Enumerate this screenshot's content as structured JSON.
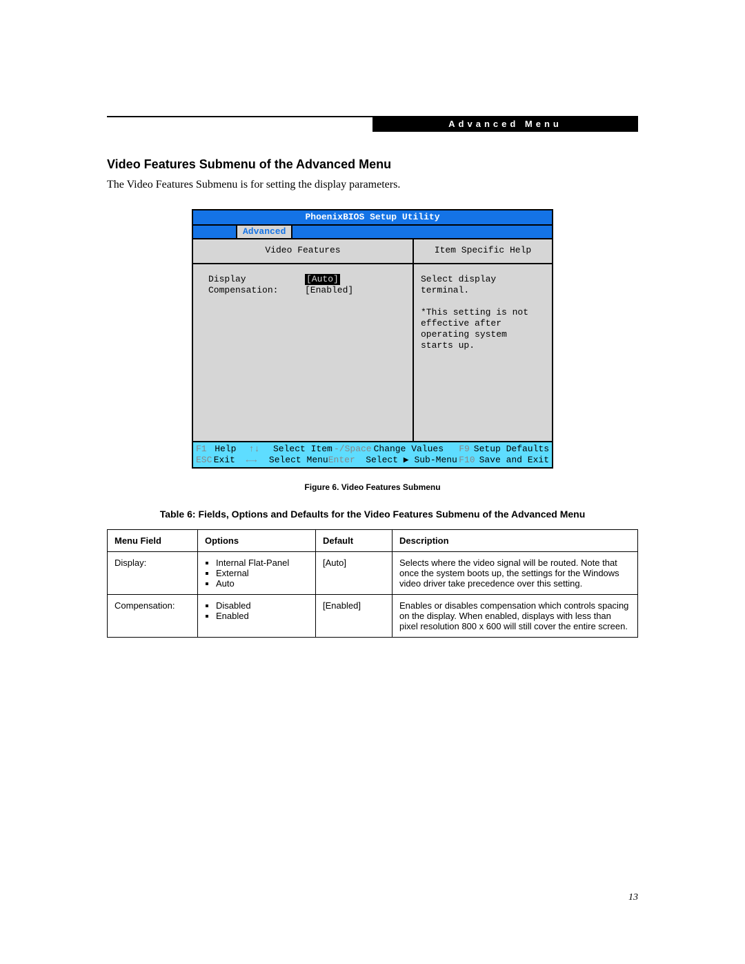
{
  "header": {
    "label": "Advanced Menu"
  },
  "section": {
    "heading": "Video Features Submenu of the Advanced Menu",
    "intro": "The Video Features Submenu is for setting the display parameters."
  },
  "bios": {
    "title": "PhoenixBIOS Setup Utility",
    "menu_tab": "Advanced",
    "left_header": "Video Features",
    "right_header": "Item Specific Help",
    "fields": {
      "display_label": "Display",
      "display_value": "[Auto]",
      "comp_label": "Compensation:",
      "comp_value": "[Enabled]"
    },
    "help": {
      "line1": "Select display terminal.",
      "line2": "*This setting is not",
      "line3": "effective after",
      "line4": "operating system",
      "line5": "starts up."
    },
    "footer": {
      "r1": {
        "k1": "F1",
        "a1": "Help",
        "k2": "↑↓",
        "a2": "Select Item",
        "k3": "-/Space",
        "a3": "Change Values",
        "k4": "F9",
        "a4": "Setup Defaults"
      },
      "r2": {
        "k1": "ESC",
        "a1": "Exit",
        "k2": "←→",
        "a2": "Select Menu",
        "k3": "Enter",
        "a3": "Select ▶ Sub-Menu",
        "k4": "F10",
        "a4": "Save and Exit"
      }
    }
  },
  "figure_caption": "Figure 6.   Video Features Submenu",
  "table": {
    "title": "Table 6: Fields, Options and Defaults for the Video Features Submenu of the Advanced Menu",
    "headers": {
      "field": "Menu Field",
      "options": "Options",
      "def": "Default",
      "desc": "Description"
    },
    "rows": [
      {
        "field": "Display:",
        "options": [
          "Internal Flat-Panel",
          "External",
          "Auto"
        ],
        "def": "[Auto]",
        "desc": "Selects where the video signal will be routed. Note that once the system boots up, the settings for the Windows video driver take precedence over this setting."
      },
      {
        "field": "Compensation:",
        "options": [
          "Disabled",
          "Enabled"
        ],
        "def": "[Enabled]",
        "desc": "Enables or disables compensation which controls spacing on the display. When enabled, displays with less than pixel resolution 800 x 600 will still cover the entire screen."
      }
    ]
  },
  "page_number": "13"
}
